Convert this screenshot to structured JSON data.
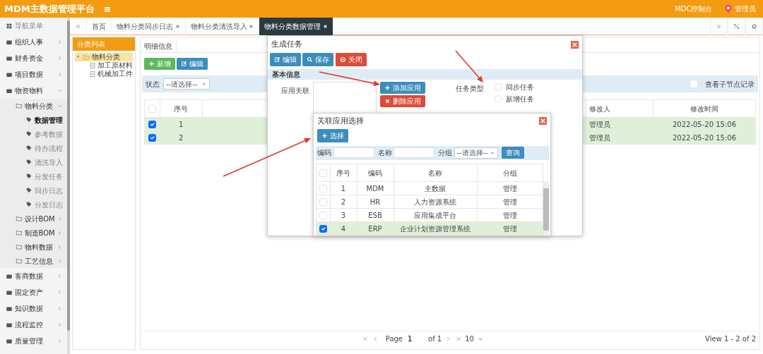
{
  "header": {
    "title": "MDM主数据管理平台",
    "console_link": "MDC控制台",
    "user": "管理员"
  },
  "sidebar": {
    "title": "导航菜单",
    "items": [
      {
        "kind": "group",
        "label": "组织人事",
        "expanded": false,
        "selected": false
      },
      {
        "kind": "group",
        "label": "财务资金",
        "expanded": false,
        "selected": false
      },
      {
        "kind": "group",
        "label": "项目数据",
        "expanded": false,
        "selected": false
      },
      {
        "kind": "group",
        "label": "物资物料",
        "expanded": true,
        "selected": false,
        "children": [
          {
            "kind": "folder",
            "label": "物料分类",
            "expanded": true,
            "selected": false,
            "children": [
              {
                "kind": "leaf",
                "label": "数据管理",
                "selected": true
              },
              {
                "kind": "leaf",
                "label": "参考数据",
                "selected": false
              },
              {
                "kind": "leaf",
                "label": "待办流程",
                "selected": false
              },
              {
                "kind": "leaf",
                "label": "清洗导入",
                "selected": false
              },
              {
                "kind": "leaf",
                "label": "分发任务",
                "selected": false
              },
              {
                "kind": "leaf",
                "label": "同步日志",
                "selected": false
              },
              {
                "kind": "leaf",
                "label": "分发日志",
                "selected": false
              }
            ]
          },
          {
            "kind": "folder",
            "label": "设计BOM",
            "expanded": false,
            "selected": false
          },
          {
            "kind": "folder",
            "label": "制造BOM",
            "expanded": false,
            "selected": false
          },
          {
            "kind": "folder",
            "label": "物料数据",
            "expanded": false,
            "selected": false
          },
          {
            "kind": "folder",
            "label": "工艺信息",
            "expanded": false,
            "selected": false
          }
        ]
      },
      {
        "kind": "group",
        "label": "客商数据",
        "expanded": false,
        "selected": false
      },
      {
        "kind": "group",
        "label": "固定资产",
        "expanded": false,
        "selected": false
      },
      {
        "kind": "group",
        "label": "知识数据",
        "expanded": false,
        "selected": false
      },
      {
        "kind": "group",
        "label": "流程监控",
        "expanded": false,
        "selected": false
      },
      {
        "kind": "group",
        "label": "质量管理",
        "expanded": false,
        "selected": false
      }
    ]
  },
  "tabs": [
    {
      "label": "首页",
      "closable": false,
      "selected": false
    },
    {
      "label": "物料分类同步日志",
      "closable": true,
      "selected": false
    },
    {
      "label": "物料分类清洗导入",
      "closable": true,
      "selected": false
    },
    {
      "label": "物料分类数据管理",
      "closable": true,
      "selected": true
    }
  ],
  "tree_panel": {
    "title": "分类列表",
    "tree": [
      {
        "label": "物料分类",
        "expanded": true,
        "selected": true,
        "children": [
          {
            "label": "加工原材料",
            "selected": false
          },
          {
            "label": "机械加工件",
            "selected": false
          }
        ]
      }
    ]
  },
  "detail": {
    "tab": "明细信息",
    "buttons": [
      {
        "label": "新增",
        "kind": "success"
      },
      {
        "label": "编辑",
        "kind": "primary"
      }
    ],
    "filter": {
      "label": "状态",
      "placeholder": "--请选择--"
    },
    "show_children": {
      "label": "查看子节点记录",
      "checked": false
    },
    "table": {
      "select_all": {
        "checked": false
      },
      "columns": [
        "序号",
        "修改人",
        "修改时间"
      ],
      "rows": [
        {
          "selected": true,
          "cells": [
            "1",
            "管理员",
            "2022-05-20 15:06"
          ]
        },
        {
          "selected": true,
          "cells": [
            "2",
            "管理员",
            "2022-05-20 15:06"
          ]
        }
      ]
    },
    "pagination": {
      "page_label": "Page",
      "page": "1",
      "of": "of 1",
      "page_size": "10",
      "summary": "View 1 - 2 of 2"
    }
  },
  "task_dialog": {
    "title": "生成任务",
    "buttons": [
      {
        "label": "编辑",
        "kind": "primary"
      },
      {
        "label": "保存",
        "kind": "primary"
      },
      {
        "label": "关闭",
        "kind": "danger"
      }
    ],
    "section": "基本信息",
    "app_label": "应用关联",
    "app_buttons": [
      {
        "label": "添加应用",
        "kind": "primary"
      },
      {
        "label": "删除应用",
        "kind": "danger"
      }
    ],
    "type_label": "任务类型",
    "type_options": [
      {
        "label": "同步任务",
        "selected": false
      },
      {
        "label": "新增任务",
        "selected": false
      }
    ]
  },
  "app_dialog": {
    "title": "关联应用选择",
    "select_button": "选择",
    "filters": [
      {
        "label": "编码",
        "kind": "input"
      },
      {
        "label": "名称",
        "kind": "input"
      },
      {
        "label": "分组",
        "kind": "select",
        "placeholder": "--请选择--"
      }
    ],
    "query_button": "查询",
    "table": {
      "select_all": {
        "checked": false
      },
      "columns": [
        "序号",
        "编码",
        "名称",
        "分组"
      ],
      "rows": [
        {
          "selected": false,
          "cells": [
            "1",
            "MDM",
            "主数据",
            "管理"
          ]
        },
        {
          "selected": false,
          "cells": [
            "2",
            "HR",
            "人力资源系统",
            "管理"
          ]
        },
        {
          "selected": false,
          "cells": [
            "3",
            "ESB",
            "应用集成平台",
            "管理"
          ]
        },
        {
          "selected": true,
          "cells": [
            "4",
            "ERP",
            "企业计划资源管理系统",
            "管理"
          ]
        }
      ]
    }
  }
}
